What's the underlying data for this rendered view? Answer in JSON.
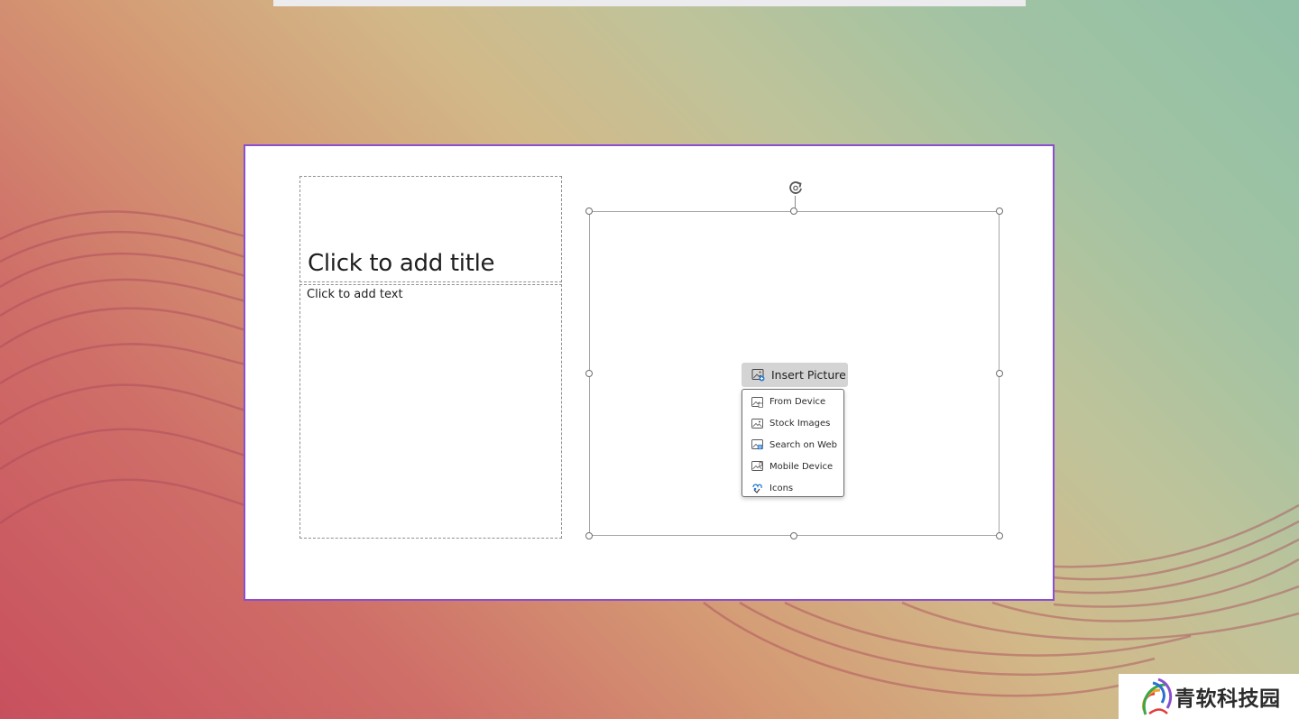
{
  "slide": {
    "title_placeholder": "Click to add title",
    "body_placeholder": "Click to add text"
  },
  "insert_picture": {
    "button_label": "Insert Picture",
    "button_icon": "insert-picture-icon",
    "menu_items": [
      {
        "label": "From Device",
        "icon": "device-picture-icon"
      },
      {
        "label": "Stock Images",
        "icon": "stock-images-icon"
      },
      {
        "label": "Search on Web",
        "icon": "web-picture-icon"
      },
      {
        "label": "Mobile Device",
        "icon": "mobile-picture-icon"
      },
      {
        "label": "Icons",
        "icon": "icons-icon"
      }
    ]
  },
  "watermark": {
    "text": "青软科技园",
    "logo_icon": "brand-logo-icon"
  },
  "colors": {
    "slide_border": "#8a4fd0",
    "menu_border": "#6f6f6f",
    "button_bg": "#d4d4d4"
  }
}
